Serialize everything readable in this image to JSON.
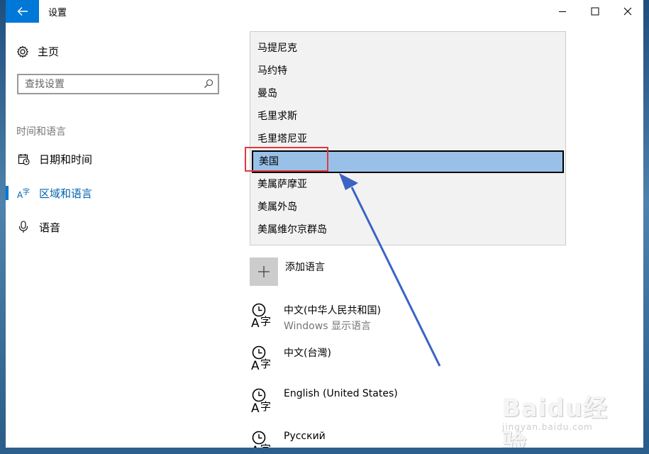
{
  "window": {
    "title": "设置"
  },
  "sidebar": {
    "home_label": "主页",
    "search_placeholder": "查找设置",
    "section_label": "时间和语言",
    "items": [
      {
        "label": "日期和时间"
      },
      {
        "label": "区域和语言"
      },
      {
        "label": "语音"
      }
    ]
  },
  "dropdown": {
    "options": [
      "马提尼克",
      "马约特",
      "曼岛",
      "毛里求斯",
      "毛里塔尼亚",
      "美国",
      "美属萨摩亚",
      "美属外岛",
      "美属维尔京群岛"
    ],
    "selected": "美国"
  },
  "content": {
    "add_language_label": "添加语言",
    "languages": [
      {
        "name": "中文(中华人民共和国)",
        "sub": "Windows 显示语言"
      },
      {
        "name": "中文(台灣)"
      },
      {
        "name": "English (United States)"
      },
      {
        "name": "Русский"
      }
    ]
  },
  "watermark": {
    "brand": "Baidu经验",
    "url": "jingyan.baidu.com"
  },
  "colors": {
    "accent": "#0078d7",
    "selection": "#99c1e8",
    "highlight_box": "#e0393e",
    "annotation_arrow": "#3a63c4"
  },
  "icons": {
    "back": "back-arrow-icon",
    "home": "gear-icon",
    "search": "search-icon",
    "date_time": "calendar-clock-icon",
    "region_language": "region-language-icon",
    "speech": "microphone-icon",
    "add": "plus-icon",
    "language": "language-pack-icon"
  }
}
